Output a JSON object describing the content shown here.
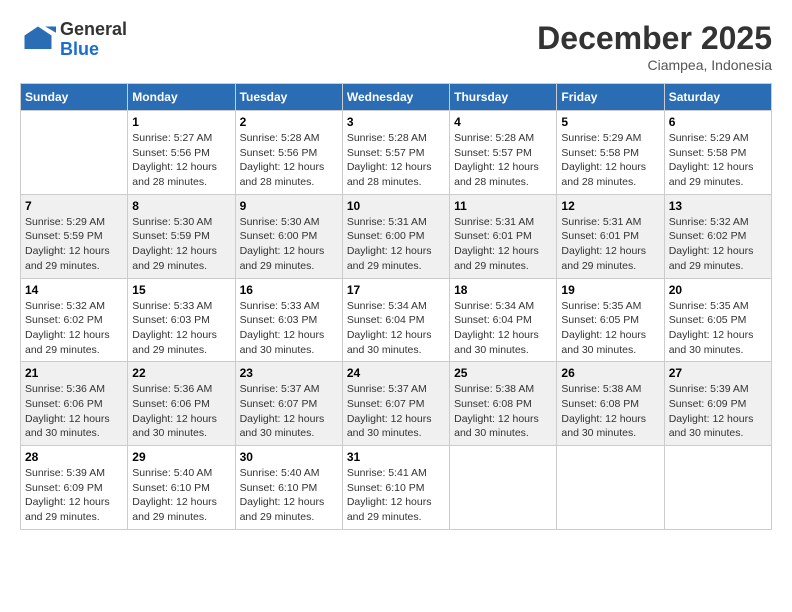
{
  "header": {
    "logo_general": "General",
    "logo_blue": "Blue",
    "month_title": "December 2025",
    "subtitle": "Ciampea, Indonesia"
  },
  "days_of_week": [
    "Sunday",
    "Monday",
    "Tuesday",
    "Wednesday",
    "Thursday",
    "Friday",
    "Saturday"
  ],
  "weeks": [
    [
      {
        "day": "",
        "sunrise": "",
        "sunset": "",
        "daylight": ""
      },
      {
        "day": "1",
        "sunrise": "Sunrise: 5:27 AM",
        "sunset": "Sunset: 5:56 PM",
        "daylight": "Daylight: 12 hours and 28 minutes."
      },
      {
        "day": "2",
        "sunrise": "Sunrise: 5:28 AM",
        "sunset": "Sunset: 5:56 PM",
        "daylight": "Daylight: 12 hours and 28 minutes."
      },
      {
        "day": "3",
        "sunrise": "Sunrise: 5:28 AM",
        "sunset": "Sunset: 5:57 PM",
        "daylight": "Daylight: 12 hours and 28 minutes."
      },
      {
        "day": "4",
        "sunrise": "Sunrise: 5:28 AM",
        "sunset": "Sunset: 5:57 PM",
        "daylight": "Daylight: 12 hours and 28 minutes."
      },
      {
        "day": "5",
        "sunrise": "Sunrise: 5:29 AM",
        "sunset": "Sunset: 5:58 PM",
        "daylight": "Daylight: 12 hours and 28 minutes."
      },
      {
        "day": "6",
        "sunrise": "Sunrise: 5:29 AM",
        "sunset": "Sunset: 5:58 PM",
        "daylight": "Daylight: 12 hours and 29 minutes."
      }
    ],
    [
      {
        "day": "7",
        "sunrise": "Sunrise: 5:29 AM",
        "sunset": "Sunset: 5:59 PM",
        "daylight": "Daylight: 12 hours and 29 minutes."
      },
      {
        "day": "8",
        "sunrise": "Sunrise: 5:30 AM",
        "sunset": "Sunset: 5:59 PM",
        "daylight": "Daylight: 12 hours and 29 minutes."
      },
      {
        "day": "9",
        "sunrise": "Sunrise: 5:30 AM",
        "sunset": "Sunset: 6:00 PM",
        "daylight": "Daylight: 12 hours and 29 minutes."
      },
      {
        "day": "10",
        "sunrise": "Sunrise: 5:31 AM",
        "sunset": "Sunset: 6:00 PM",
        "daylight": "Daylight: 12 hours and 29 minutes."
      },
      {
        "day": "11",
        "sunrise": "Sunrise: 5:31 AM",
        "sunset": "Sunset: 6:01 PM",
        "daylight": "Daylight: 12 hours and 29 minutes."
      },
      {
        "day": "12",
        "sunrise": "Sunrise: 5:31 AM",
        "sunset": "Sunset: 6:01 PM",
        "daylight": "Daylight: 12 hours and 29 minutes."
      },
      {
        "day": "13",
        "sunrise": "Sunrise: 5:32 AM",
        "sunset": "Sunset: 6:02 PM",
        "daylight": "Daylight: 12 hours and 29 minutes."
      }
    ],
    [
      {
        "day": "14",
        "sunrise": "Sunrise: 5:32 AM",
        "sunset": "Sunset: 6:02 PM",
        "daylight": "Daylight: 12 hours and 29 minutes."
      },
      {
        "day": "15",
        "sunrise": "Sunrise: 5:33 AM",
        "sunset": "Sunset: 6:03 PM",
        "daylight": "Daylight: 12 hours and 29 minutes."
      },
      {
        "day": "16",
        "sunrise": "Sunrise: 5:33 AM",
        "sunset": "Sunset: 6:03 PM",
        "daylight": "Daylight: 12 hours and 30 minutes."
      },
      {
        "day": "17",
        "sunrise": "Sunrise: 5:34 AM",
        "sunset": "Sunset: 6:04 PM",
        "daylight": "Daylight: 12 hours and 30 minutes."
      },
      {
        "day": "18",
        "sunrise": "Sunrise: 5:34 AM",
        "sunset": "Sunset: 6:04 PM",
        "daylight": "Daylight: 12 hours and 30 minutes."
      },
      {
        "day": "19",
        "sunrise": "Sunrise: 5:35 AM",
        "sunset": "Sunset: 6:05 PM",
        "daylight": "Daylight: 12 hours and 30 minutes."
      },
      {
        "day": "20",
        "sunrise": "Sunrise: 5:35 AM",
        "sunset": "Sunset: 6:05 PM",
        "daylight": "Daylight: 12 hours and 30 minutes."
      }
    ],
    [
      {
        "day": "21",
        "sunrise": "Sunrise: 5:36 AM",
        "sunset": "Sunset: 6:06 PM",
        "daylight": "Daylight: 12 hours and 30 minutes."
      },
      {
        "day": "22",
        "sunrise": "Sunrise: 5:36 AM",
        "sunset": "Sunset: 6:06 PM",
        "daylight": "Daylight: 12 hours and 30 minutes."
      },
      {
        "day": "23",
        "sunrise": "Sunrise: 5:37 AM",
        "sunset": "Sunset: 6:07 PM",
        "daylight": "Daylight: 12 hours and 30 minutes."
      },
      {
        "day": "24",
        "sunrise": "Sunrise: 5:37 AM",
        "sunset": "Sunset: 6:07 PM",
        "daylight": "Daylight: 12 hours and 30 minutes."
      },
      {
        "day": "25",
        "sunrise": "Sunrise: 5:38 AM",
        "sunset": "Sunset: 6:08 PM",
        "daylight": "Daylight: 12 hours and 30 minutes."
      },
      {
        "day": "26",
        "sunrise": "Sunrise: 5:38 AM",
        "sunset": "Sunset: 6:08 PM",
        "daylight": "Daylight: 12 hours and 30 minutes."
      },
      {
        "day": "27",
        "sunrise": "Sunrise: 5:39 AM",
        "sunset": "Sunset: 6:09 PM",
        "daylight": "Daylight: 12 hours and 30 minutes."
      }
    ],
    [
      {
        "day": "28",
        "sunrise": "Sunrise: 5:39 AM",
        "sunset": "Sunset: 6:09 PM",
        "daylight": "Daylight: 12 hours and 29 minutes."
      },
      {
        "day": "29",
        "sunrise": "Sunrise: 5:40 AM",
        "sunset": "Sunset: 6:10 PM",
        "daylight": "Daylight: 12 hours and 29 minutes."
      },
      {
        "day": "30",
        "sunrise": "Sunrise: 5:40 AM",
        "sunset": "Sunset: 6:10 PM",
        "daylight": "Daylight: 12 hours and 29 minutes."
      },
      {
        "day": "31",
        "sunrise": "Sunrise: 5:41 AM",
        "sunset": "Sunset: 6:10 PM",
        "daylight": "Daylight: 12 hours and 29 minutes."
      },
      {
        "day": "",
        "sunrise": "",
        "sunset": "",
        "daylight": ""
      },
      {
        "day": "",
        "sunrise": "",
        "sunset": "",
        "daylight": ""
      },
      {
        "day": "",
        "sunrise": "",
        "sunset": "",
        "daylight": ""
      }
    ]
  ],
  "row_shading": [
    false,
    true,
    false,
    true,
    false
  ]
}
